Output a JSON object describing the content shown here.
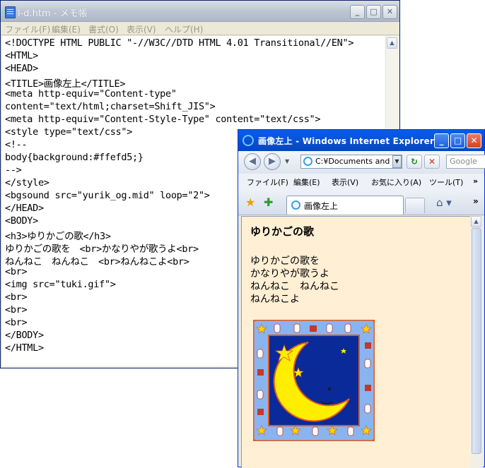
{
  "notepad": {
    "title": "l-d.htm - メモ帳",
    "menu": [
      "ファイル(F)",
      "編集(E)",
      "書式(O)",
      "表示(V)",
      "ヘルプ(H)"
    ],
    "lines": [
      "<!DOCTYPE HTML PUBLIC \"-//W3C//DTD HTML 4.01 Transitional//EN\">",
      "<HTML>",
      "<HEAD>",
      "<TITLE>画像左上</TITLE>",
      "<meta http-equiv=\"Content-type\"",
      "content=\"text/html;charset=Shift_JIS\">",
      "<meta http-equiv=\"Content-Style-Type\" content=\"text/css\">",
      "<style type=\"text/css\">",
      "<!--",
      "body{background:#ffefd5;}",
      "-->",
      "</style>",
      "<bgsound src=\"yurik_og.mid\" loop=\"2\">",
      "</HEAD>",
      "<BODY>",
      "<h3>ゆりかごの歌</h3>",
      "ゆりかごの歌を　<br>かなりやが歌うよ<br>",
      "ねんねこ　ねんねこ　<br>ねんねこよ<br>",
      "<br>",
      "<img src=\"tuki.gif\">",
      "<br>",
      "<br>",
      "<br>",
      "</BODY>",
      "</HTML>"
    ]
  },
  "ie": {
    "title": "画像左上 - Windows Internet Explorer",
    "address": "C:¥Documents and S",
    "search_placeholder": "Google",
    "menu": [
      "ファイル(F)",
      "編集(E)",
      "表示(V)",
      "お気に入り(A)",
      "ツール(T)"
    ],
    "tab_label": "画像左上",
    "page": {
      "heading": "ゆりかごの歌",
      "lines": [
        "ゆりかごの歌を",
        "かなりやが歌うよ",
        "ねんねこ　ねんねこ",
        "ねんねこよ"
      ]
    }
  },
  "colors": {
    "page_background": "#ffefd5",
    "ie_titlebar": "#0653d8",
    "moon": "#ffee00",
    "night": "#0b2a9a",
    "frame": "#8ab4f0"
  }
}
